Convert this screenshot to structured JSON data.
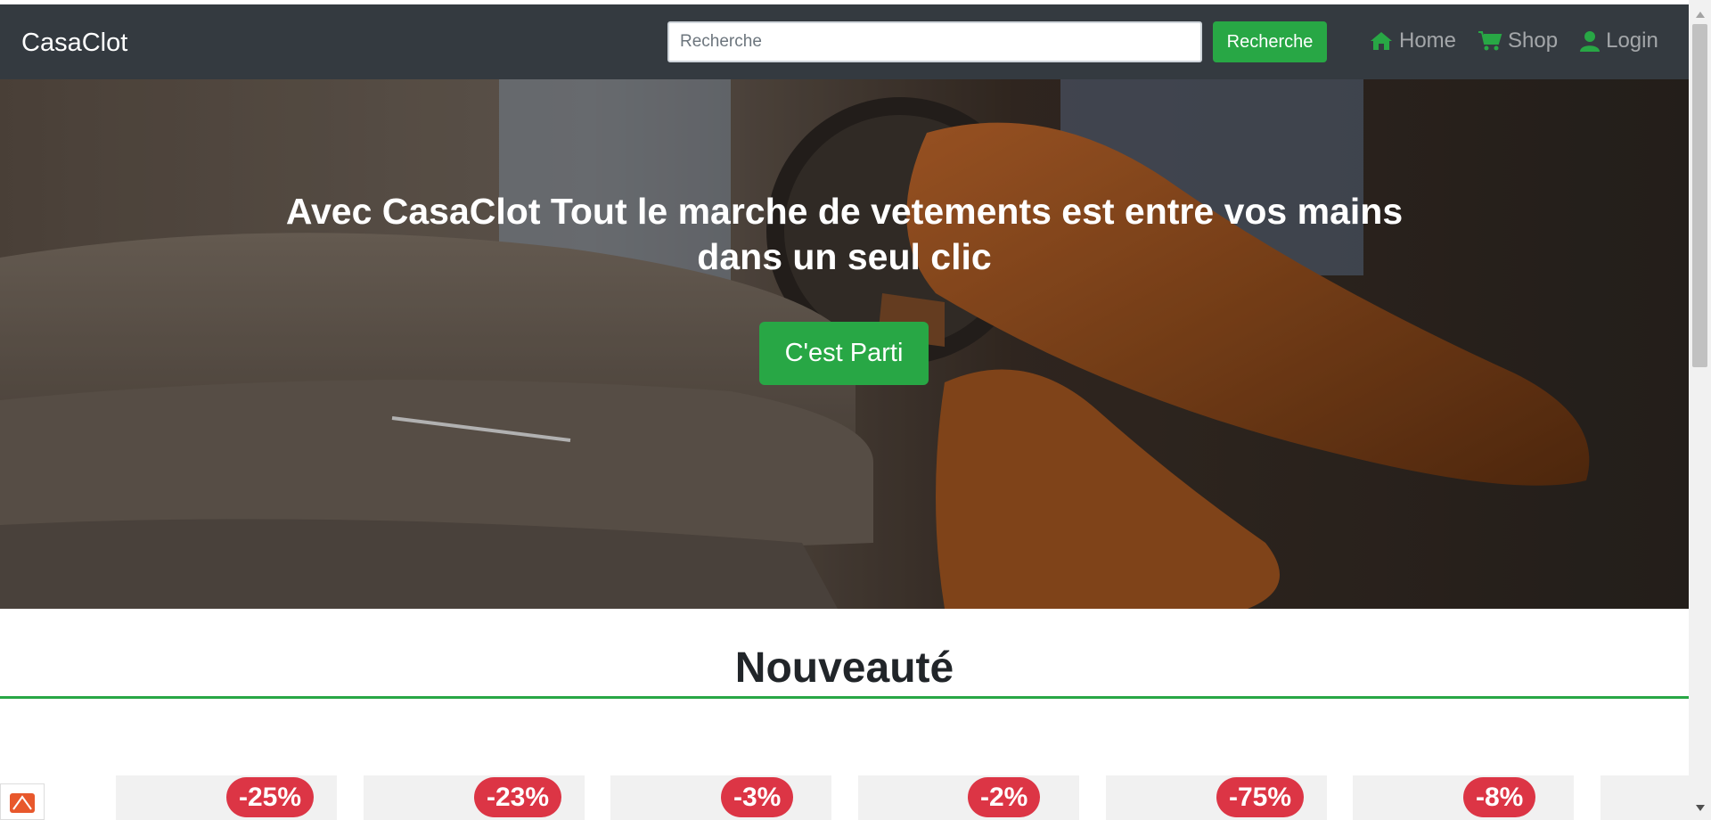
{
  "navbar": {
    "brand": "CasaClot",
    "search": {
      "placeholder": "Recherche",
      "value": "",
      "button_label": "Recherche"
    },
    "links": [
      {
        "label": "Home",
        "icon": "home-icon"
      },
      {
        "label": "Shop",
        "icon": "cart-icon"
      },
      {
        "label": "Login",
        "icon": "user-icon"
      }
    ]
  },
  "hero": {
    "title": "Avec CasaClot Tout le marche de vetements est entre vos mains dans un seul clic",
    "cta_label": "C'est Parti",
    "image": "hero-clothing-shoes-photo"
  },
  "section": {
    "title": "Nouveauté"
  },
  "products": [
    {
      "discount": "-25%"
    },
    {
      "discount": "-23%"
    },
    {
      "discount": "-3%"
    },
    {
      "discount": "-2%"
    },
    {
      "discount": "-75%"
    },
    {
      "discount": "-8%"
    }
  ],
  "colors": {
    "navbar_bg": "#343a40",
    "accent_green": "#28a745",
    "badge_red": "#dc3545"
  }
}
